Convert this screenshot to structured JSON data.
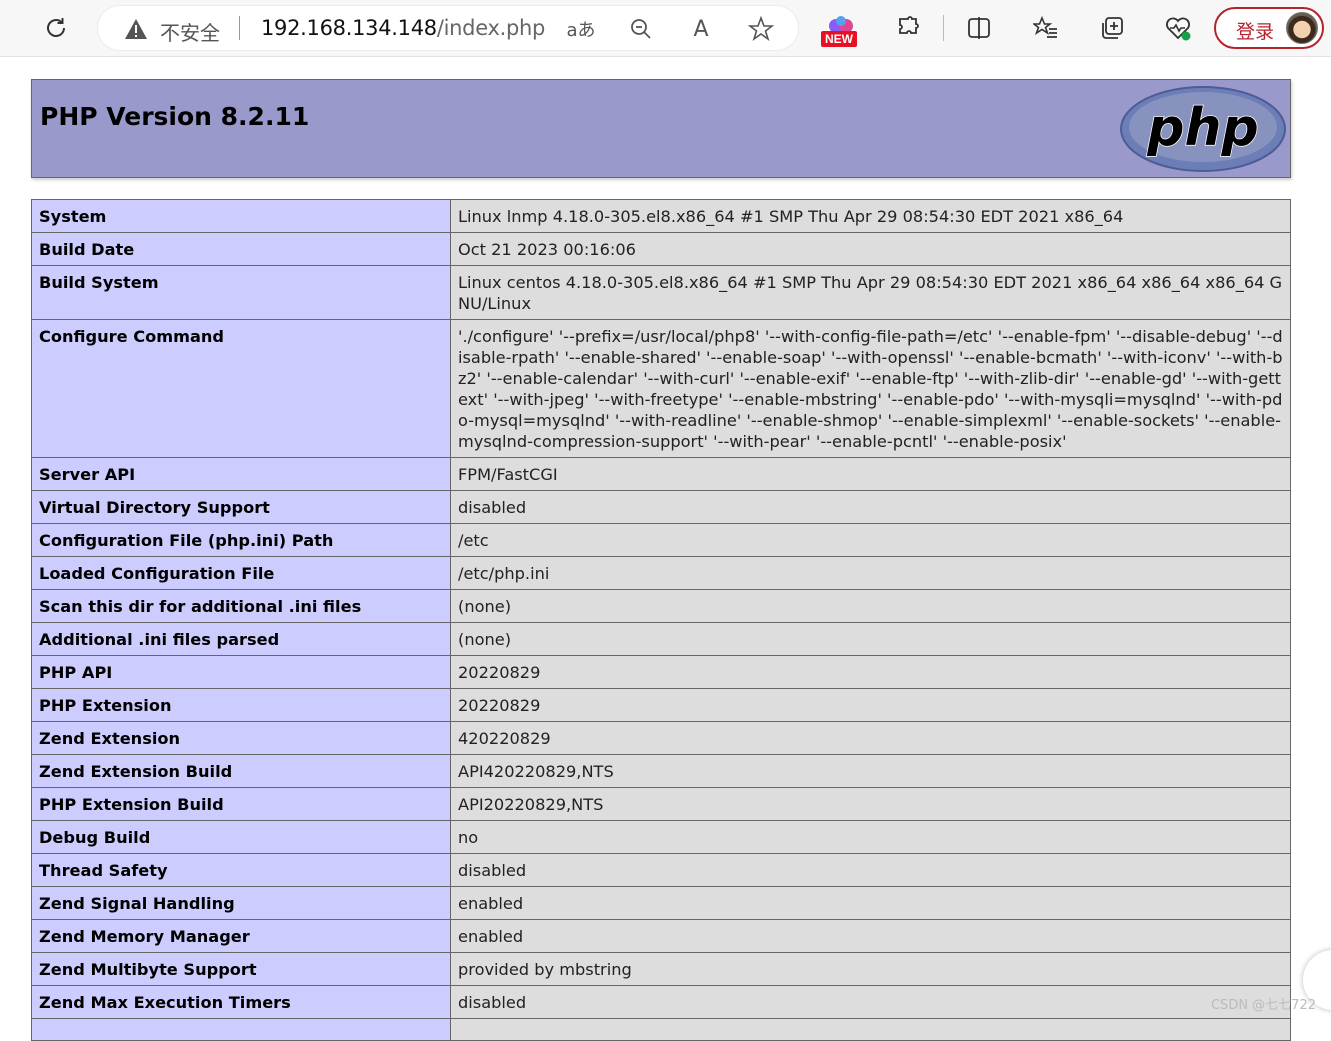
{
  "browser": {
    "security_label": "不安全",
    "url_host": "192.168.134.148",
    "url_path": "/index.php",
    "translate_label": "aあ",
    "read_aloud_label": "A",
    "new_badge": "NEW",
    "login_label": "登录",
    "colors": {
      "login_accent": "#b4232b",
      "new_badge": "#e81123"
    },
    "icons": [
      "refresh-icon",
      "warning-icon",
      "translate-icon",
      "zoom-icon",
      "read-aloud-icon",
      "favorite-star-icon",
      "copilot-icon",
      "extensions-icon",
      "split-screen-icon",
      "favorites-icon",
      "collections-icon",
      "browser-essentials-icon",
      "avatar"
    ]
  },
  "header": {
    "title": "PHP Version 8.2.11",
    "logo_text": "php",
    "colors": {
      "header_bg": "#9999cc",
      "key_bg": "#ccccff",
      "value_bg": "#dddddd"
    }
  },
  "rows": [
    {
      "key": "System",
      "value": "Linux lnmp 4.18.0-305.el8.x86_64 #1 SMP Thu Apr 29 08:54:30 EDT 2021 x86_64"
    },
    {
      "key": "Build Date",
      "value": "Oct 21 2023 00:16:06"
    },
    {
      "key": "Build System",
      "value": "Linux centos 4.18.0-305.el8.x86_64 #1 SMP Thu Apr 29 08:54:30 EDT 2021 x86_64 x86_64 x86_64 GNU/Linux"
    },
    {
      "key": "Configure Command",
      "value": "'./configure' '--prefix=/usr/local/php8' '--with-config-file-path=/etc' '--enable-fpm' '--disable-debug' '--disable-rpath' '--enable-shared' '--enable-soap' '--with-openssl' '--enable-bcmath' '--with-iconv' '--with-bz2' '--enable-calendar' '--with-curl' '--enable-exif' '--enable-ftp' '--with-zlib-dir' '--enable-gd' '--with-gettext' '--with-jpeg' '--with-freetype' '--enable-mbstring' '--enable-pdo' '--with-mysqli=mysqlnd' '--with-pdo-mysql=mysqlnd' '--with-readline' '--enable-shmop' '--enable-simplexml' '--enable-sockets' '--enable-mysqlnd-compression-support' '--with-pear' '--enable-pcntl' '--enable-posix'"
    },
    {
      "key": "Server API",
      "value": "FPM/FastCGI"
    },
    {
      "key": "Virtual Directory Support",
      "value": "disabled"
    },
    {
      "key": "Configuration File (php.ini) Path",
      "value": "/etc"
    },
    {
      "key": "Loaded Configuration File",
      "value": "/etc/php.ini"
    },
    {
      "key": "Scan this dir for additional .ini files",
      "value": "(none)"
    },
    {
      "key": "Additional .ini files parsed",
      "value": "(none)"
    },
    {
      "key": "PHP API",
      "value": "20220829"
    },
    {
      "key": "PHP Extension",
      "value": "20220829"
    },
    {
      "key": "Zend Extension",
      "value": "420220829"
    },
    {
      "key": "Zend Extension Build",
      "value": "API420220829,NTS"
    },
    {
      "key": "PHP Extension Build",
      "value": "API20220829,NTS"
    },
    {
      "key": "Debug Build",
      "value": "no"
    },
    {
      "key": "Thread Safety",
      "value": "disabled"
    },
    {
      "key": "Zend Signal Handling",
      "value": "enabled"
    },
    {
      "key": "Zend Memory Manager",
      "value": "enabled"
    },
    {
      "key": "Zend Multibyte Support",
      "value": "provided by mbstring"
    },
    {
      "key": "Zend Max Execution Timers",
      "value": "disabled"
    }
  ],
  "watermark": "CSDN @七七722"
}
